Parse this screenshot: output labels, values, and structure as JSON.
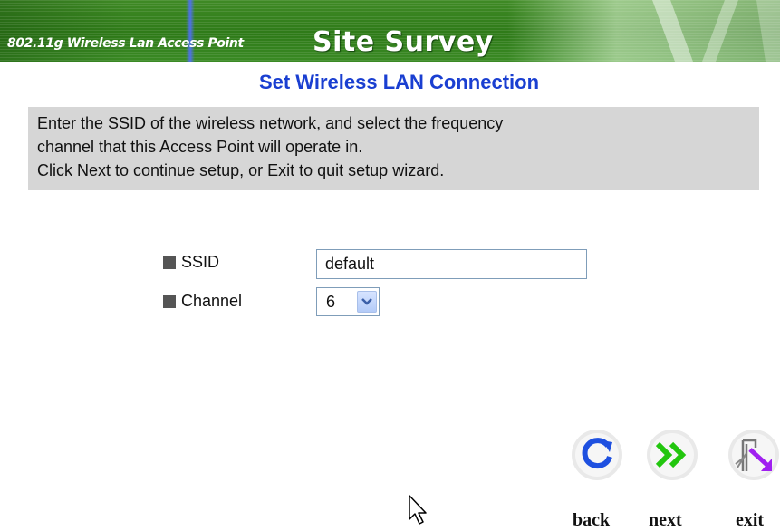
{
  "header": {
    "model_text": "802.11g Wireless Lan Access Point",
    "title": "Site Survey"
  },
  "subtitle": "Set Wireless LAN Connection",
  "instructions": {
    "lines": [
      "Enter the SSID of the wireless network, and select the frequency",
      "channel that this Access Point will operate in.",
      "Click Next to continue setup, or Exit to quit setup wizard."
    ]
  },
  "form": {
    "ssid": {
      "label": "SSID",
      "value": "default"
    },
    "channel": {
      "label": "Channel",
      "selected": "6"
    }
  },
  "nav": {
    "back_label": "back",
    "next_label": "next",
    "exit_label": "exit"
  },
  "colors": {
    "banner_green": "#2e7a18",
    "subtitle_blue": "#1a3fd1",
    "instructions_bg": "#d6d6d6"
  }
}
